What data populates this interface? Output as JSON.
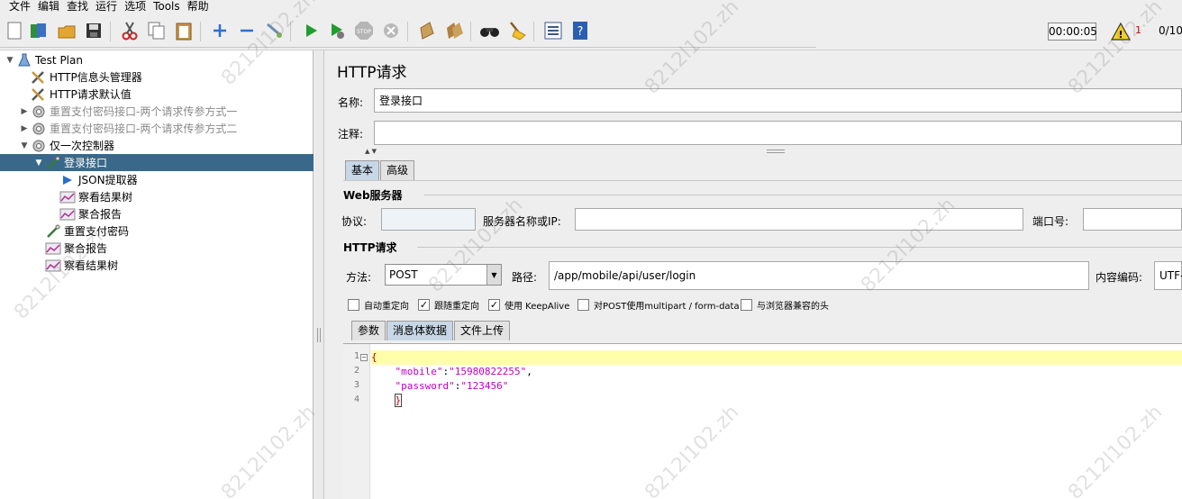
{
  "menu": {
    "items": [
      "文件",
      "编辑",
      "查找",
      "运行",
      "选项",
      "Tools",
      "帮助"
    ]
  },
  "toolbar": {
    "timer": "00:00:05",
    "warning_count": "1",
    "threads": "0/10",
    "icons": [
      "new-icon",
      "templates-icon",
      "open-icon",
      "save-icon",
      "cut-icon",
      "copy-icon",
      "paste-icon",
      "expand-icon",
      "collapse-icon",
      "toggle-icon",
      "start-icon",
      "start-no-pause-icon",
      "stop-icon",
      "shutdown-icon",
      "clear-icon",
      "clear-all-icon",
      "search-icon",
      "reset-search-icon",
      "function-helper-icon",
      "help-icon"
    ]
  },
  "tree": {
    "items": [
      {
        "label": "Test Plan",
        "level": 0,
        "toggle": "▼",
        "icon": "test-plan-icon",
        "disabled": false,
        "selected": false
      },
      {
        "label": "HTTP信息头管理器",
        "level": 1,
        "toggle": "",
        "icon": "wrench-icon",
        "disabled": false,
        "selected": false
      },
      {
        "label": "HTTP请求默认值",
        "level": 1,
        "toggle": "",
        "icon": "wrench-icon",
        "disabled": false,
        "selected": false
      },
      {
        "label": "重置支付密码接口-两个请求传参方式一",
        "level": 1,
        "toggle": "▶",
        "icon": "controller-icon",
        "disabled": true,
        "selected": false
      },
      {
        "label": "重置支付密码接口-两个请求传参方式二",
        "level": 1,
        "toggle": "▶",
        "icon": "controller-icon",
        "disabled": true,
        "selected": false
      },
      {
        "label": "仅一次控制器",
        "level": 1,
        "toggle": "▼",
        "icon": "controller-icon",
        "disabled": false,
        "selected": false
      },
      {
        "label": "登录接口",
        "level": 2,
        "toggle": "▼",
        "icon": "sampler-icon",
        "disabled": false,
        "selected": true
      },
      {
        "label": "JSON提取器",
        "level": 3,
        "toggle": "",
        "icon": "extractor-icon",
        "disabled": false,
        "selected": false
      },
      {
        "label": "察看结果树",
        "level": 3,
        "toggle": "",
        "icon": "listener-icon",
        "disabled": false,
        "selected": false
      },
      {
        "label": "聚合报告",
        "level": 3,
        "toggle": "",
        "icon": "listener-icon",
        "disabled": false,
        "selected": false
      },
      {
        "label": "重置支付密码",
        "level": 2,
        "toggle": "",
        "icon": "sampler-icon",
        "disabled": false,
        "selected": false
      },
      {
        "label": "聚合报告",
        "level": 2,
        "toggle": "",
        "icon": "listener-icon",
        "disabled": false,
        "selected": false
      },
      {
        "label": "察看结果树",
        "level": 2,
        "toggle": "",
        "icon": "listener-icon",
        "disabled": false,
        "selected": false
      }
    ]
  },
  "panel": {
    "title": "HTTP请求",
    "name_label": "名称:",
    "name_value": "登录接口",
    "comment_label": "注释:",
    "comment_value": "",
    "tabs": [
      "基本",
      "高级"
    ],
    "web_server_title": "Web服务器",
    "protocol_label": "协议:",
    "protocol_value": "",
    "server_label": "服务器名称或IP:",
    "server_value": "",
    "port_label": "端口号:",
    "port_value": "",
    "http_request_title": "HTTP请求",
    "method_label": "方法:",
    "method_value": "POST",
    "path_label": "路径:",
    "path_value": "/app/mobile/api/user/login",
    "encoding_label": "内容编码:",
    "encoding_value": "UTF-",
    "checkboxes": [
      {
        "label": "自动重定向",
        "checked": false
      },
      {
        "label": "跟随重定向",
        "checked": true
      },
      {
        "label": "使用 KeepAlive",
        "checked": true
      },
      {
        "label": "对POST使用multipart / form-data",
        "checked": false
      },
      {
        "label": "与浏览器兼容的头",
        "checked": false
      }
    ],
    "body_tabs": [
      "参数",
      "消息体数据",
      "文件上传"
    ]
  },
  "editor": {
    "line_numbers": [
      "1",
      "2",
      "3",
      "4"
    ],
    "line1": "{",
    "line2_key": "\"mobile\"",
    "line2_val": "\"15980822255\"",
    "line3_key": "\"password\"",
    "line3_val": "\"123456\"",
    "line4": "}"
  },
  "watermark": "8212l102.zh"
}
